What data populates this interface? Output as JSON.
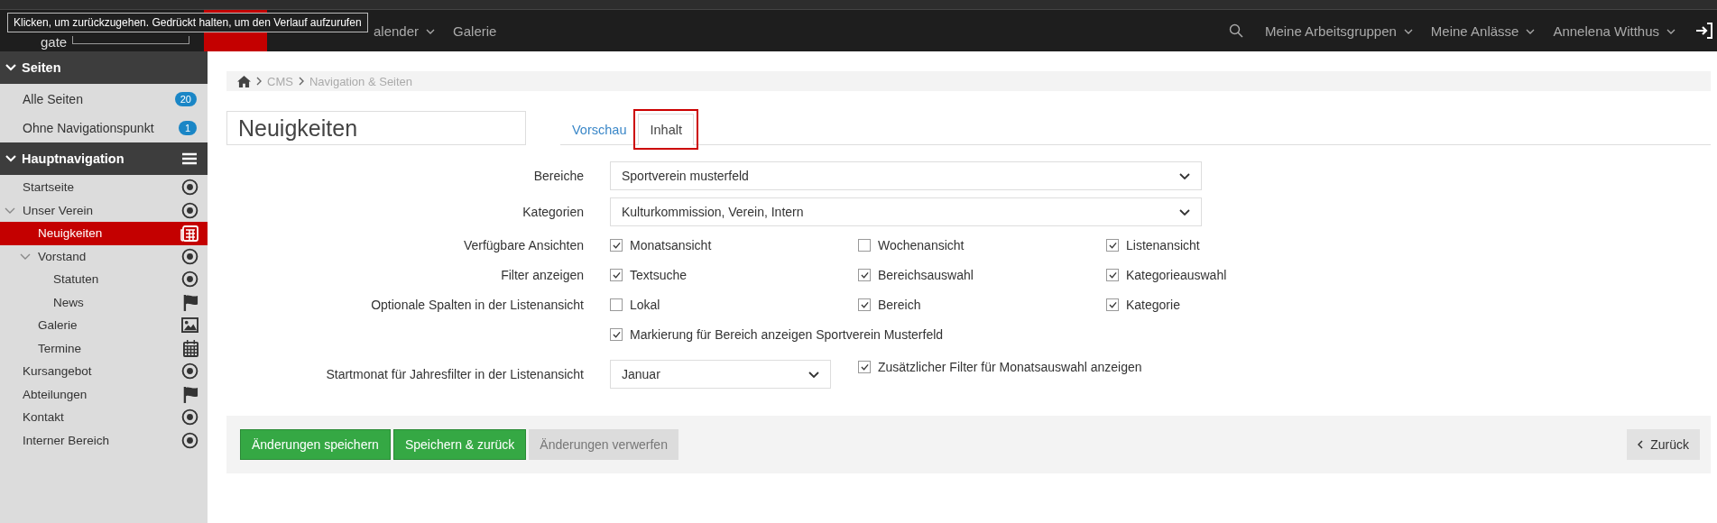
{
  "tooltip": "Klicken, um zurückzugehen. Gedrückt halten, um den Verlauf aufzurufen",
  "topbar": {
    "logo": "gate",
    "nav": [
      {
        "label": "alender",
        "dropdown": true
      },
      {
        "label": "Galerie",
        "dropdown": false
      }
    ],
    "right": [
      {
        "label": "Meine Arbeitsgruppen"
      },
      {
        "label": "Meine Anlässe"
      },
      {
        "label": "Annelena Witthus"
      }
    ]
  },
  "sidebar": {
    "sections": [
      {
        "title": "Seiten",
        "menu": false,
        "items": [
          {
            "label": "Alle Seiten",
            "badge": "20"
          },
          {
            "label": "Ohne Navigationspunkt",
            "badge": "1"
          }
        ]
      },
      {
        "title": "Hauptnavigation",
        "menu": true,
        "tree": [
          {
            "label": "Startseite",
            "kind": "target",
            "selected": false
          },
          {
            "label": "Unser Verein",
            "kind": "target",
            "selected": false,
            "expanded": true,
            "children": [
              {
                "label": "Neuigkeiten",
                "kind": "news",
                "selected": true
              },
              {
                "label": "Vorstand",
                "kind": "target",
                "selected": false,
                "expanded": true,
                "children": [
                  {
                    "label": "Statuten",
                    "kind": "target",
                    "selected": false
                  },
                  {
                    "label": "News",
                    "kind": "flag",
                    "selected": false
                  }
                ]
              },
              {
                "label": "Galerie",
                "kind": "image",
                "selected": false
              },
              {
                "label": "Termine",
                "kind": "calendar",
                "selected": false
              }
            ]
          },
          {
            "label": "Kursangebot",
            "kind": "target",
            "selected": false
          },
          {
            "label": "Abteilungen",
            "kind": "flag",
            "selected": false
          },
          {
            "label": "Kontakt",
            "kind": "target",
            "selected": false
          },
          {
            "label": "Interner Bereich",
            "kind": "target",
            "selected": false
          }
        ]
      }
    ]
  },
  "breadcrumb": [
    "CMS",
    "Navigation & Seiten"
  ],
  "title": "Neuigkeiten",
  "tabs": [
    {
      "label": "Vorschau",
      "selected": false
    },
    {
      "label": "Inhalt",
      "selected": true
    }
  ],
  "form": [
    {
      "kind": "select",
      "label": "Bereiche",
      "value": "Sportverein musterfeld",
      "wide": true
    },
    {
      "kind": "select",
      "label": "Kategorien",
      "value": "Kulturkommission, Verein, Intern",
      "wide": true
    },
    {
      "kind": "checks",
      "label": "Verfügbare Ansichten",
      "options": [
        {
          "label": "Monatsansicht",
          "checked": true
        },
        {
          "label": "Wochenansicht",
          "checked": false
        },
        {
          "label": "Listenansicht",
          "checked": true
        }
      ]
    },
    {
      "kind": "checks",
      "label": "Filter anzeigen",
      "options": [
        {
          "label": "Textsuche",
          "checked": true
        },
        {
          "label": "Bereichsauswahl",
          "checked": true
        },
        {
          "label": "Kategorieauswahl",
          "checked": true
        }
      ]
    },
    {
      "kind": "checks",
      "label": "Optionale Spalten in der Listenansicht",
      "options": [
        {
          "label": "Lokal",
          "checked": false
        },
        {
          "label": "Bereich",
          "checked": true
        },
        {
          "label": "Kategorie",
          "checked": true
        }
      ]
    },
    {
      "kind": "checks",
      "options": [
        {
          "label": "Markierung für Bereich anzeigen Sportverein Musterfeld",
          "checked": true
        }
      ]
    },
    {
      "kind": "select",
      "label": "Startmonat für Jahresfilter in der Listenansicht",
      "value": "Januar",
      "wide": false,
      "extra": {
        "label": "Zusätzlicher Filter für Monatsauswahl anzeigen",
        "checked": true
      }
    }
  ],
  "buttons": [
    {
      "label": "Änderungen speichern",
      "kind": "primary"
    },
    {
      "label": "Speichern & zurück",
      "kind": "primary"
    },
    {
      "label": "Änderungen verwerfen",
      "kind": "muted"
    }
  ],
  "back": "Zurück"
}
